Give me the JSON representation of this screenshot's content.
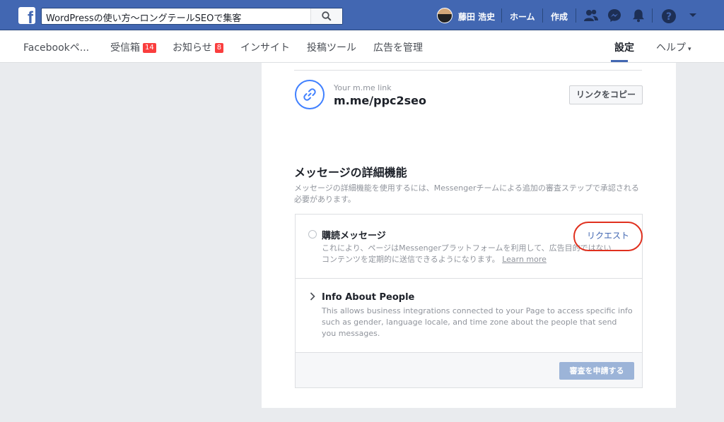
{
  "topbar": {
    "logo_letter": "f",
    "search_value": "WordPressの使い方〜ロングテールSEOで集客",
    "profile_name": "藤田 浩史",
    "home_label": "ホーム",
    "create_label": "作成",
    "icons": [
      "friends-icon",
      "messenger-icon",
      "notifications-icon",
      "help-icon",
      "account-menu-icon"
    ]
  },
  "pagenav": {
    "tabs": [
      {
        "label": "Facebookペ..."
      },
      {
        "label": "受信箱",
        "badge": "14"
      },
      {
        "label": "お知らせ",
        "badge": "8"
      },
      {
        "label": "インサイト"
      },
      {
        "label": "投稿ツール"
      },
      {
        "label": "広告を管理"
      }
    ],
    "settings_label": "設定",
    "help_label": "ヘルプ",
    "help_caret": "▾"
  },
  "mme": {
    "label": "Your m.me link",
    "value": "m.me/ppc2seo",
    "copy_button": "リンクをコピー"
  },
  "advanced": {
    "title": "メッセージの詳細機能",
    "description": "メッセージの詳細機能を使用するには、Messengerチームによる追加の審査ステップで承認される必要があります。",
    "subscription": {
      "title": "購読メッセージ",
      "description": "これにより、ページはMessengerプラットフォームを利用して、広告目的ではないコンテンツを定期的に送信できるようになります。",
      "learn_more": "Learn more",
      "request_label": "リクエスト"
    },
    "info_people": {
      "title": "Info About People",
      "description": "This allows business integrations connected to your Page to access specific info such as gender, language locale, and time zone about the people that send you messages."
    },
    "submit_button": "審査を申請する"
  },
  "colors": {
    "brand_blue": "#4267b2",
    "highlight_red": "#e0301e",
    "badge_red": "#fa3e3e"
  }
}
